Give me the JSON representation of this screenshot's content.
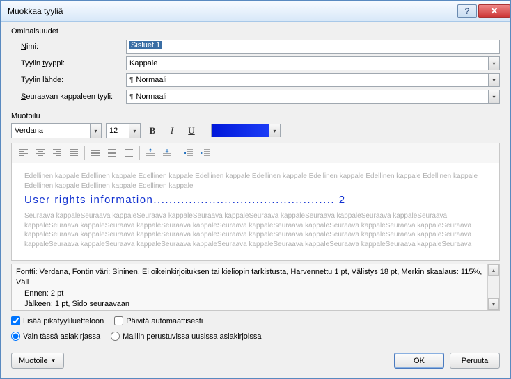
{
  "title": "Muokkaa tyyliä",
  "props_label": "Ominaisuudet",
  "rows": {
    "name_label": "Nimi:",
    "name_value": "Sisluet 1",
    "type_label": "Tyylin tyyppi:",
    "type_value": "Kappale",
    "based_label": "Tyylin lähde:",
    "based_value": "Normaali",
    "next_label": "Seuraavan kappaleen tyyli:",
    "next_value": "Normaali"
  },
  "format_label": "Muotoilu",
  "font_name": "Verdana",
  "font_size": "12",
  "preview": {
    "prev_para": "Edellinen kappale Edellinen kappale Edellinen kappale Edellinen kappale Edellinen kappale Edellinen kappale Edellinen kappale Edellinen kappale Edellinen kappale Edellinen kappale Edellinen kappale",
    "heading_text": "User rights information",
    "heading_page": "2",
    "next_para": "Seuraava kappaleSeuraava kappaleSeuraava kappaleSeuraava kappaleSeuraava kappaleSeuraava kappaleSeuraava kappaleSeuraava kappaleSeuraava kappaleSeuraava kappaleSeuraava kappaleSeuraava kappaleSeuraava kappaleSeuraava kappaleSeuraava kappaleSeuraava kappaleSeuraava kappaleSeuraava kappaleSeuraava kappaleSeuraava kappaleSeuraava kappaleSeuraava kappaleSeuraava kappaleSeuraava kappaleSeuraava kappaleSeuraava kappaleSeuraava kappaleSeuraava kappaleSeuraava kappaleSeuraava kappaleSeuraava kappaleSeuraava"
  },
  "desc": {
    "line1": "Fontti: Verdana, Fontin väri: Sininen, Ei oikeinkirjoituksen tai kieliopin tarkistusta, Harvennettu  1 pt, Välistys 18 pt, Merkin skaalaus: 115%, Väli",
    "line2": "Ennen:  2 pt",
    "line3": "Jälkeen:  1 pt, Sido seuraavaan"
  },
  "check1": "Lisää pikatyyliluetteloon",
  "check2": "Päivitä automaattisesti",
  "radio1": "Vain tässä asiakirjassa",
  "radio2": "Malliin perustuvissa uusissa asiakirjoissa",
  "format_btn": "Muotoile",
  "ok": "OK",
  "cancel": "Peruuta"
}
